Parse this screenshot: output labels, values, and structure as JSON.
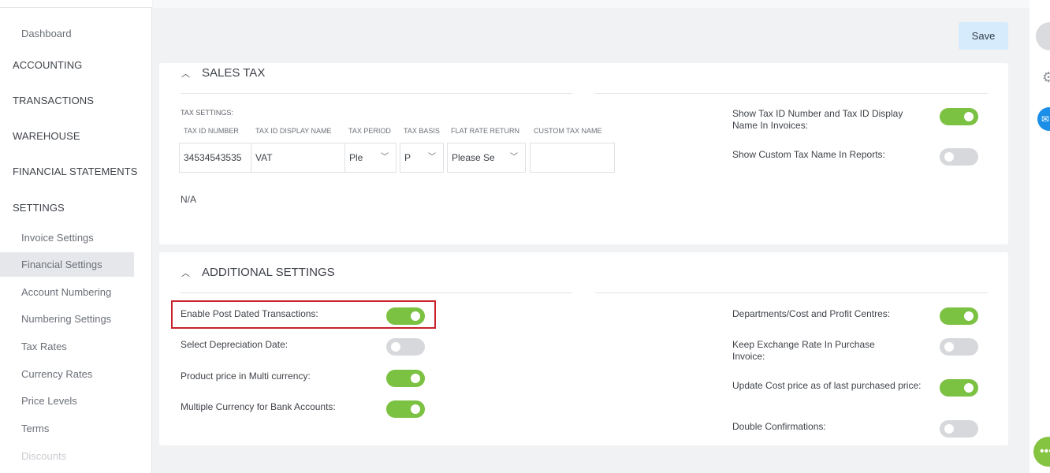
{
  "sidebar": {
    "dashboard": "Dashboard",
    "accounting": "ACCOUNTING",
    "transactions": "TRANSACTIONS",
    "warehouse": "WAREHOUSE",
    "financial_statements": "FINANCIAL STATEMENTS",
    "settings": "SETTINGS",
    "sub_items": [
      "Invoice Settings",
      "Financial Settings",
      "Account Numbering",
      "Numbering Settings",
      "Tax Rates",
      "Currency Rates",
      "Price Levels",
      "Terms",
      "Discounts"
    ],
    "active_item": "Financial Settings"
  },
  "toolbar": {
    "save_label": "Save"
  },
  "sales_tax": {
    "title": "SALES TAX",
    "tax_settings_label": "TAX SETTINGS:",
    "columns": [
      "TAX ID NUMBER",
      "TAX ID DISPLAY NAME",
      "TAX PERIOD",
      "TAX BASIS",
      "FLAT RATE RETURN",
      "CUSTOM TAX NAME"
    ],
    "values": {
      "tax_id_number": "34534543535",
      "tax_id_display_name": "VAT",
      "tax_period": "Ple",
      "tax_basis": "P",
      "flat_rate_return": "Please Se",
      "custom_tax_name": ""
    },
    "na_text": "N/A",
    "right_settings": [
      {
        "label": "Show Tax ID Number and Tax ID Display Name In Invoices:",
        "on": true
      },
      {
        "label": "Show Custom Tax Name In Reports:",
        "on": false
      }
    ]
  },
  "additional": {
    "title": "ADDITIONAL SETTINGS",
    "left_settings": [
      {
        "label": "Enable Post Dated Transactions:",
        "on": true
      },
      {
        "label": "Select Depreciation Date:",
        "on": false
      },
      {
        "label": "Product price in Multi currency:",
        "on": true
      },
      {
        "label": "Multiple Currency for Bank Accounts:",
        "on": true
      }
    ],
    "right_settings": [
      {
        "label": "Departments/Cost and Profit Centres:",
        "on": true
      },
      {
        "label": "Keep Exchange Rate In Purchase Invoice:",
        "on": false
      },
      {
        "label": "Update Cost price as of last purchased price:",
        "on": true
      },
      {
        "label": "Double Confirmations:",
        "on": false
      }
    ]
  },
  "colors": {
    "toggle_on": "#7bc142",
    "toggle_off": "#d6d8db",
    "highlight": "#c8232c",
    "save_bg": "#d6ebfb"
  },
  "icons": [
    "chevron-up-icon",
    "gear-icon",
    "mail-icon",
    "chat-icon",
    "dropdown-chevron-icon"
  ]
}
